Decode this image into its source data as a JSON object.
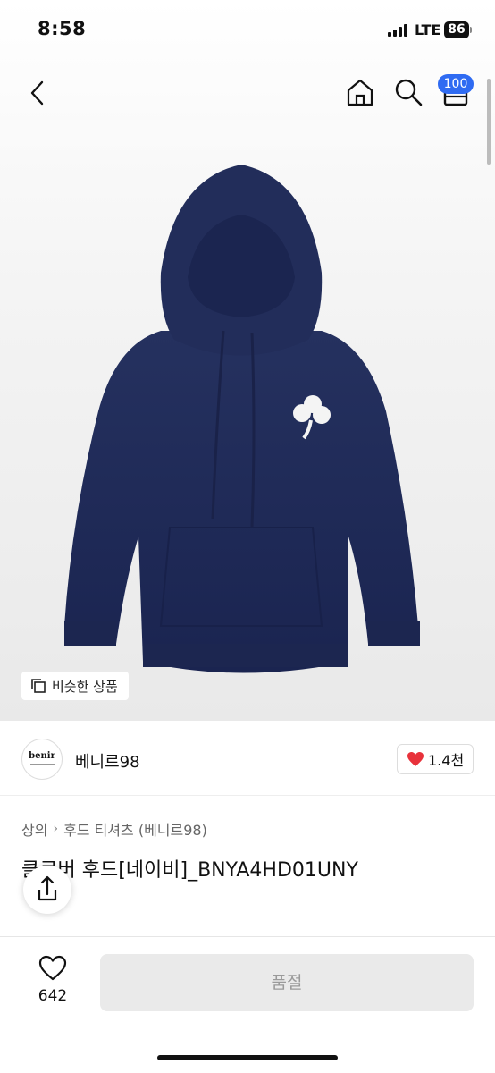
{
  "status_bar": {
    "time": "8:58",
    "network": "LTE",
    "battery": "86"
  },
  "nav": {
    "cart_badge": "100",
    "icons": [
      "back-arrow-icon",
      "home-icon",
      "search-icon",
      "cart-icon"
    ]
  },
  "image": {
    "similar_button": "비슷한 상품"
  },
  "brand": {
    "name": "베니르98",
    "logo_text": "benir",
    "likes": "1.4천"
  },
  "breadcrumb": {
    "category": "상의",
    "subcategory": "후드 티셔츠 (베니르98)"
  },
  "product": {
    "title": "클로버 후드[네이비]_BNYA4HD01UNY"
  },
  "bottom": {
    "wish_count": "642",
    "buy_button": "품절"
  },
  "colors": {
    "accent_blue": "#2f6bf2",
    "heart_red": "#e8323b",
    "hoodie_navy": "#1e2a57"
  }
}
